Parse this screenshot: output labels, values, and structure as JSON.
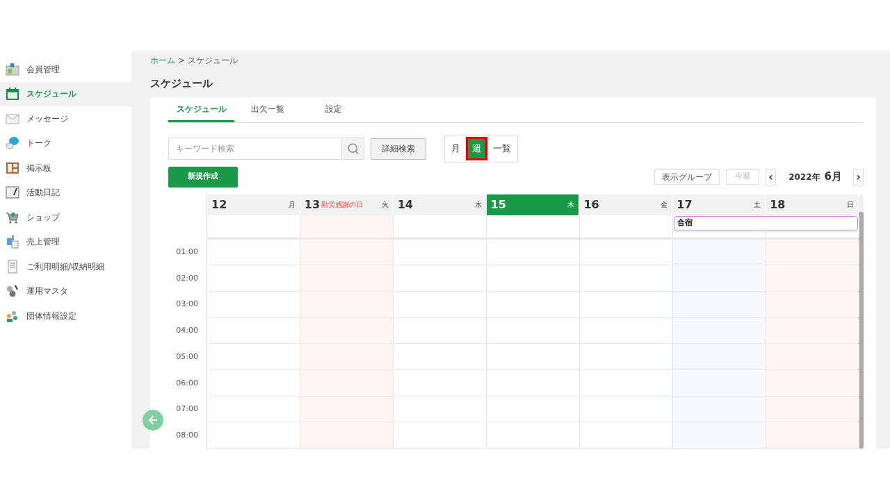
{
  "sidebar": {
    "items": [
      {
        "label": "会員管理",
        "selected": false
      },
      {
        "label": "スケジュール",
        "selected": true
      },
      {
        "label": "メッセージ",
        "selected": false
      },
      {
        "label": "トーク",
        "selected": false
      },
      {
        "label": "掲示板",
        "selected": false
      },
      {
        "label": "活動日記",
        "selected": false
      },
      {
        "label": "ショップ",
        "selected": false
      },
      {
        "label": "売上管理",
        "selected": false
      },
      {
        "label": "ご利用明細/収納明細",
        "selected": false
      },
      {
        "label": "運用マスタ",
        "selected": false
      },
      {
        "label": "団体情報設定",
        "selected": false
      }
    ]
  },
  "breadcrumb": {
    "home": "ホーム",
    "separator": ">",
    "current": "スケジュール"
  },
  "page_title": "スケジュール",
  "tabs": [
    {
      "label": "スケジュール",
      "selected": true
    },
    {
      "label": "出欠一覧",
      "selected": false
    },
    {
      "label": "設定",
      "selected": false
    }
  ],
  "search": {
    "placeholder": "キーワード検索",
    "advanced_button": "詳細検索"
  },
  "view_modes": [
    {
      "label": "月",
      "selected": false
    },
    {
      "label": "週",
      "selected": true
    },
    {
      "label": "一覧",
      "selected": false
    }
  ],
  "new_button": "新規作成",
  "group_button": "表示グループ",
  "this_week_button": {
    "label": "今週",
    "disabled": true
  },
  "month_nav": {
    "prev": "‹",
    "year": "2022年",
    "month": "6月",
    "next": "›"
  },
  "calendar": {
    "days": [
      {
        "date": "12",
        "weekday": "月",
        "kind": "weekday",
        "today": false,
        "in_event": false
      },
      {
        "date": "13",
        "weekday": "火",
        "kind": "holiday",
        "holiday": "勤労感謝の日",
        "today": false,
        "in_event": false
      },
      {
        "date": "14",
        "weekday": "水",
        "kind": "weekday",
        "today": false,
        "in_event": false
      },
      {
        "date": "15",
        "weekday": "木",
        "kind": "weekday",
        "today": true,
        "in_event": false
      },
      {
        "date": "16",
        "weekday": "金",
        "kind": "weekday",
        "today": false,
        "in_event": false
      },
      {
        "date": "17",
        "weekday": "土",
        "kind": "saturday",
        "today": false,
        "in_event": true
      },
      {
        "date": "18",
        "weekday": "日",
        "kind": "sunday",
        "today": false,
        "in_event": true
      }
    ],
    "all_day_event": {
      "title": "合宿",
      "color": "#cc77dd"
    },
    "hours": [
      "01:00",
      "02:00",
      "03:00",
      "04:00",
      "05:00",
      "06:00",
      "07:00",
      "08:00"
    ]
  }
}
